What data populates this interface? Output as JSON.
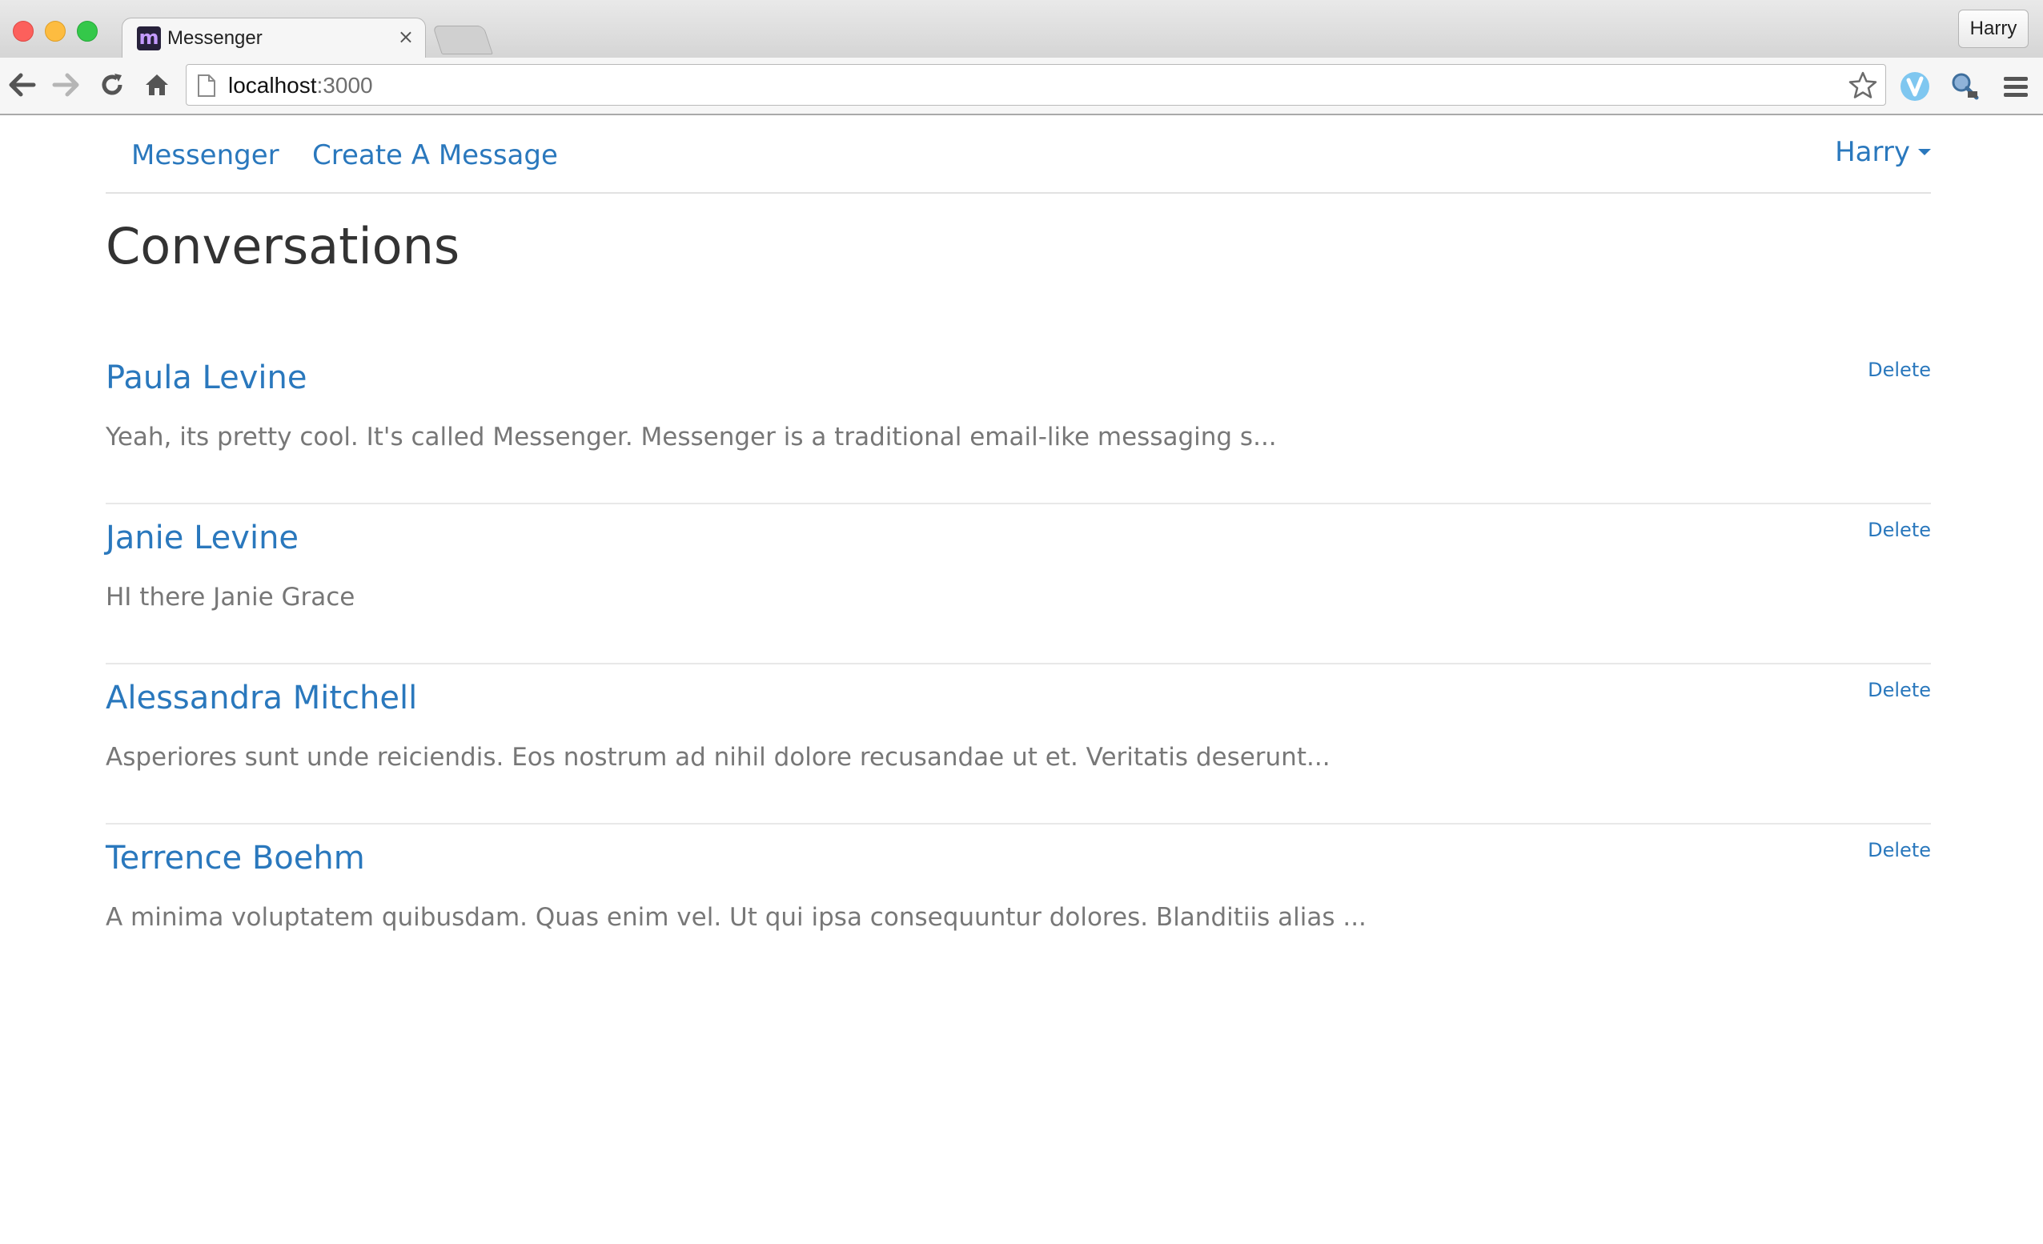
{
  "browser": {
    "tab_title": "Messenger",
    "favicon_letter": "m",
    "tab_close": "×",
    "profile_name": "Harry",
    "url_host": "localhost",
    "url_port": ":3000"
  },
  "navbar": {
    "brand": "Messenger",
    "create_link": "Create A Message",
    "user_menu": "Harry"
  },
  "page": {
    "title": "Conversations"
  },
  "conversations": [
    {
      "name": "Paula Levine",
      "preview": "Yeah, its pretty cool. It's called Messenger. Messenger is a traditional email-like messaging s...",
      "delete_label": "Delete"
    },
    {
      "name": "Janie Levine",
      "preview": "HI there Janie Grace",
      "delete_label": "Delete"
    },
    {
      "name": "Alessandra Mitchell",
      "preview": "Asperiores sunt unde reiciendis. Eos nostrum ad nihil dolore recusandae ut et. Veritatis deserunt...",
      "delete_label": "Delete"
    },
    {
      "name": "Terrence Boehm",
      "preview": "A minima voluptatem quibusdam. Quas enim vel. Ut qui ipsa consequuntur dolores. Blanditiis alias ...",
      "delete_label": "Delete"
    }
  ],
  "colors": {
    "link": "#2a78bd",
    "heading": "#333333",
    "preview_text": "#777777",
    "divider": "#e8e8e8"
  },
  "icons": {
    "back": "back-arrow-icon",
    "forward": "forward-arrow-icon",
    "reload": "reload-icon",
    "home": "home-icon",
    "page": "page-icon",
    "bookmark": "bookmark-star-icon",
    "extension_1": "vimium-extension-icon",
    "extension_2": "inspector-extension-icon",
    "menu": "hamburger-menu-icon",
    "user_caret": "caret-down-icon"
  }
}
